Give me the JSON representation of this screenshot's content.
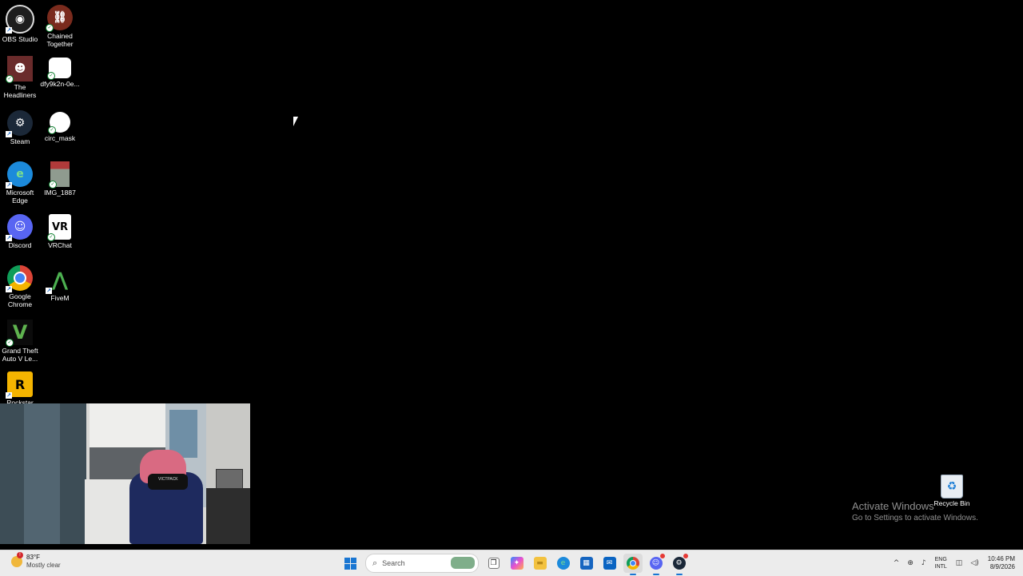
{
  "desktop_icons": {
    "col1": [
      {
        "label": "OBS Studio",
        "icon": "obs-icon",
        "color": "#1d1d1d"
      },
      {
        "label": "The Headliners",
        "icon": "headliners-icon",
        "color": "#6a2b2b"
      },
      {
        "label": "Steam",
        "icon": "steam-icon",
        "color": "#1b2838"
      },
      {
        "label": "Microsoft Edge",
        "icon": "edge-icon",
        "color": "#1c8adb"
      },
      {
        "label": "Discord",
        "icon": "discord-icon",
        "color": "#5865f2"
      },
      {
        "label": "Google Chrome",
        "icon": "chrome-icon",
        "color": "#db4437"
      },
      {
        "label": "Grand Theft Auto V Le...",
        "icon": "gta-icon",
        "color": "#2c5b2a"
      },
      {
        "label": "Rockstar",
        "icon": "rockstar-icon",
        "color": "#f4b400"
      }
    ],
    "col2": [
      {
        "label": "Chained Together",
        "icon": "chained-together-icon",
        "color": "#7a2b1d"
      },
      {
        "label": "dfy9k2n-0e...",
        "icon": "image-file-icon",
        "color": "#ffffff"
      },
      {
        "label": "circ_mask",
        "icon": "image-file-icon",
        "color": "#ffffff"
      },
      {
        "label": "IMG_1887",
        "icon": "photo-file-icon",
        "color": "#b47d7d"
      },
      {
        "label": "VRChat",
        "icon": "vrchat-icon",
        "color": "#ffffff"
      },
      {
        "label": "FiveM",
        "icon": "fivem-icon",
        "color": "#4caf50"
      }
    ],
    "glyphs": {
      "obs": "◉",
      "headliners": "☻",
      "steam": "⚙",
      "edge": "e",
      "discord": "☺",
      "chrome": "◎",
      "gta": "V",
      "rockstar": "R",
      "chained": "⛓",
      "vr": "VR",
      "fivem": "⋀"
    }
  },
  "recycle_bin": {
    "label": "Recycle Bin",
    "icon": "recycle-bin-icon",
    "glyph": "♻"
  },
  "activation": {
    "title": "Activate Windows",
    "subtitle": "Go to Settings to activate Windows."
  },
  "taskbar": {
    "weather": {
      "temp": "83°F",
      "condition": "Mostly clear",
      "badge": "!"
    },
    "search_placeholder": "Search",
    "search_glyph": "⌕",
    "apps": [
      {
        "name": "task-view",
        "glyph": "❐"
      },
      {
        "name": "copilot",
        "glyph": "✦"
      },
      {
        "name": "file-explorer",
        "glyph": "▬"
      },
      {
        "name": "edge",
        "glyph": "e"
      },
      {
        "name": "store",
        "glyph": "▦"
      },
      {
        "name": "outlook",
        "glyph": "✉"
      },
      {
        "name": "chrome",
        "glyph": "◎"
      },
      {
        "name": "discord",
        "glyph": "☺"
      },
      {
        "name": "steam",
        "glyph": "⚙"
      }
    ],
    "tray": {
      "chevron": "^",
      "network_glyph": "⊕",
      "mic_glyph": "♪",
      "lang_line1": "ENG",
      "lang_line2": "INTL",
      "wifi_glyph": "◫",
      "volume_glyph": "◁)",
      "time": "10:46 PM",
      "date": "8/9/2026"
    }
  },
  "webcam": {
    "brand_text": "VICTPACK"
  },
  "colors": {
    "taskbar_bg": "#ececec",
    "accent": "#1976d2",
    "desktop_bg": "#000000"
  }
}
